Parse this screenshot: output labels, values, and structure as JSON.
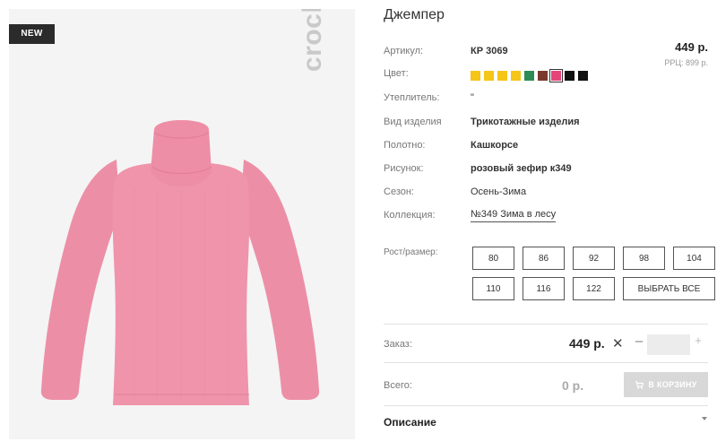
{
  "badge": {
    "new": "NEW"
  },
  "brand": {
    "logo_text": "crockid"
  },
  "product": {
    "title": "Джемпер",
    "price": "449 р.",
    "rrp": "РРЦ: 899 р."
  },
  "attributes": {
    "article": {
      "label": "Артикул:",
      "value": "КР 3069"
    },
    "color": {
      "label": "Цвет:"
    },
    "insulation": {
      "label": "Утеплитель:",
      "value": "\""
    },
    "type": {
      "label": "Вид изделия",
      "value": "Трикотажные изделия"
    },
    "fabric": {
      "label": "Полотно:",
      "value": "Кашкорсе"
    },
    "pattern": {
      "label": "Рисунок:",
      "value": "розовый зефир к349"
    },
    "season": {
      "label": "Сезон:",
      "value": "Осень-Зима"
    },
    "collection": {
      "label": "Коллекция:",
      "value": "№349 Зима в лесу"
    }
  },
  "colors": [
    {
      "hex": "#f5c518",
      "selected": false
    },
    {
      "hex": "#f5c518",
      "selected": false
    },
    {
      "hex": "#f5c518",
      "selected": false
    },
    {
      "hex": "#f5c518",
      "selected": false
    },
    {
      "hex": "#2e8b57",
      "selected": false
    },
    {
      "hex": "#7a3b2e",
      "selected": false
    },
    {
      "hex": "#e6457a",
      "selected": true
    },
    {
      "hex": "#111111",
      "selected": false
    },
    {
      "hex": "#111111",
      "selected": false
    }
  ],
  "sizes": {
    "label": "Рост/размер:",
    "options": [
      "80",
      "86",
      "92",
      "98",
      "104",
      "110",
      "116",
      "122"
    ],
    "select_all": "ВЫБРАТЬ ВСЕ"
  },
  "order": {
    "label": "Заказ:",
    "price": "449 р.",
    "times": "✕",
    "minus": "–",
    "plus": "+",
    "quantity": ""
  },
  "total": {
    "label": "Всего:",
    "price": "0 р.",
    "cart_button": "В КОРЗИНУ"
  },
  "description": {
    "title": "Описание"
  }
}
